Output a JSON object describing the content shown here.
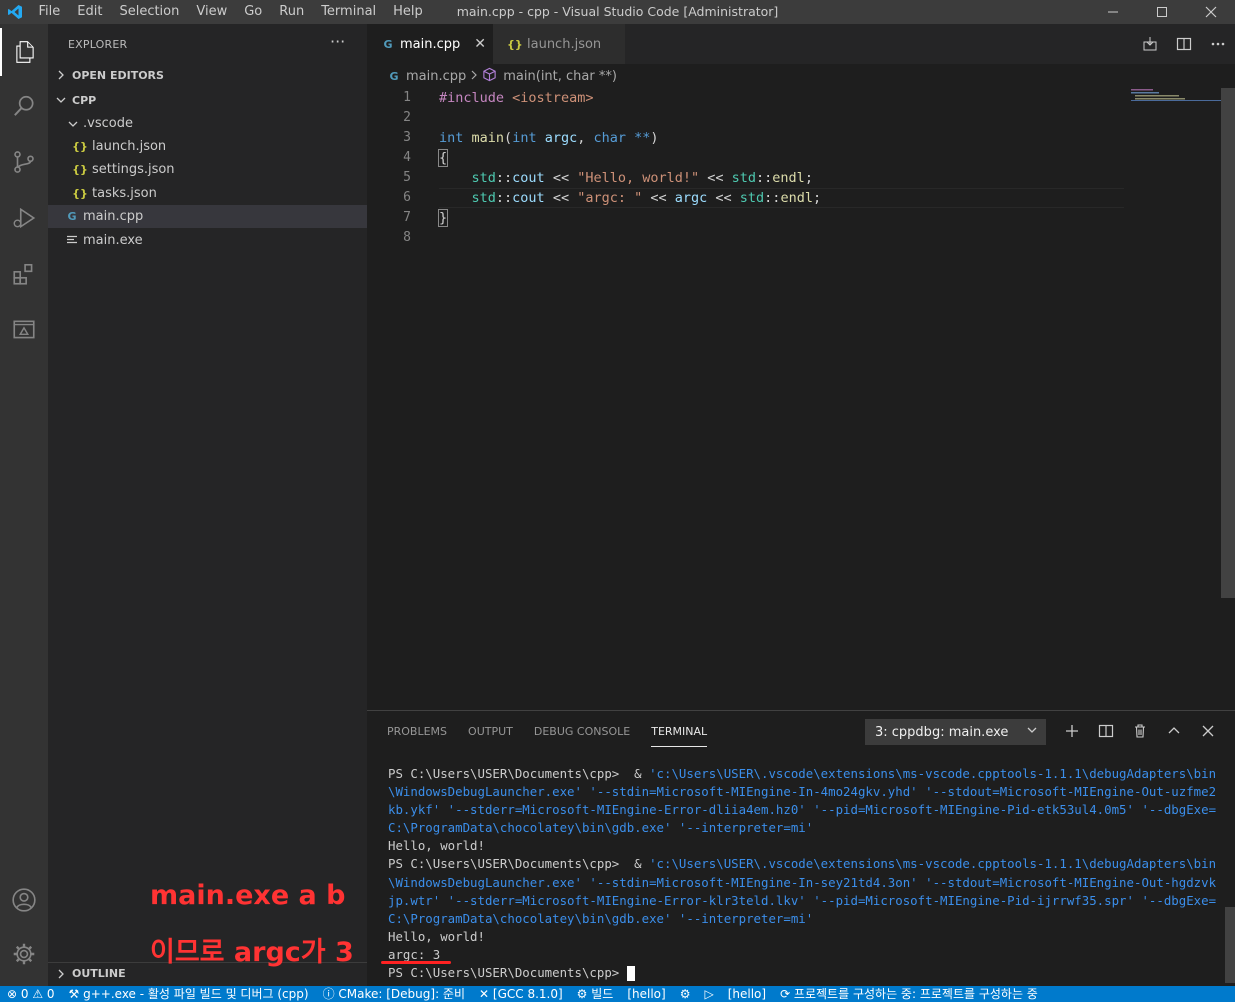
{
  "colors": {
    "status_bar": "#007acc",
    "activity_bar": "#333333",
    "sidebar": "#252526",
    "editor": "#1e1e1e",
    "annotation": "#ff3333"
  },
  "titlebar": {
    "menu": [
      "File",
      "Edit",
      "Selection",
      "View",
      "Go",
      "Run",
      "Terminal",
      "Help"
    ],
    "title": "main.cpp - cpp - Visual Studio Code [Administrator]"
  },
  "sidebar": {
    "title": "EXPLORER",
    "more": "···",
    "open_editors": "OPEN EDITORS",
    "folder": "CPP",
    "vscode_folder": ".vscode",
    "files": [
      "launch.json",
      "settings.json",
      "tasks.json"
    ],
    "cpp_file": "main.cpp",
    "exe_file": "main.exe",
    "outline": "OUTLINE",
    "json_glyph": "{}",
    "cpp_glyph": "G"
  },
  "annotation": {
    "line1": "main.exe a b",
    "line2": "이므로 argc가 3"
  },
  "tabs": [
    {
      "label": "main.cpp",
      "close": "✕"
    },
    {
      "label": "launch.json"
    }
  ],
  "breadcrumb": {
    "file": "main.cpp",
    "symbol": "main(int, char **)"
  },
  "editor": {
    "line_numbers": [
      "1",
      "2",
      "3",
      "4",
      "5",
      "6",
      "7",
      "8"
    ]
  },
  "panel": {
    "tabs": [
      "PROBLEMS",
      "OUTPUT",
      "DEBUG CONSOLE",
      "TERMINAL"
    ],
    "terminal_select": "3: cppdbg: main.exe",
    "terminal": {
      "p1_prompt": "PS C:\\Users\\USER\\Documents\\cpp>  & ",
      "p1_l1": "'c:\\Users\\USER\\.vscode\\extensions\\ms-vscode.cpptools-1.1.1\\debugAdapters\\bin",
      "p1_l2": "\\WindowsDebugLauncher.exe' '--stdin=Microsoft-MIEngine-In-4mo24gkv.yhd' '--stdout=Microsoft-MIEngine-Out-uzfme2",
      "p1_l3": "kb.ykf' '--stderr=Microsoft-MIEngine-Error-dliia4em.hz0' '--pid=Microsoft-MIEngine-Pid-etk53ul4.0m5' '--dbgExe=",
      "p1_l4": "C:\\ProgramData\\chocolatey\\bin\\gdb.exe' '--interpreter=mi'",
      "out1": "Hello, world!",
      "p2_prompt": "PS C:\\Users\\USER\\Documents\\cpp>  & ",
      "p2_l1": "'c:\\Users\\USER\\.vscode\\extensions\\ms-vscode.cpptools-1.1.1\\debugAdapters\\bin",
      "p2_l2": "\\WindowsDebugLauncher.exe' '--stdin=Microsoft-MIEngine-In-sey21td4.3on' '--stdout=Microsoft-MIEngine-Out-hgdzvk",
      "p2_l3": "jp.wtr' '--stderr=Microsoft-MIEngine-Error-klr3teld.lkv' '--pid=Microsoft-MIEngine-Pid-ijrrwf35.spr' '--dbgExe=",
      "p2_l4": "C:\\ProgramData\\chocolatey\\bin\\gdb.exe' '--interpreter=mi'",
      "out2": "Hello, world!",
      "out3": "argc: 3",
      "final_prompt": "PS C:\\Users\\USER\\Documents\\cpp> "
    }
  },
  "statusbar": {
    "errors": "⊗ 0 ⚠ 0",
    "build_task": "g++.exe - 활성 파일 빌드 및 디버그 (cpp)",
    "cmake": "ⓘ CMake: [Debug]: 준비",
    "gcc": "✕ [GCC 8.1.0]",
    "build": "⚙ 빌드",
    "hello1": "[hello]",
    "gear": "⚙",
    "run": "▷",
    "hello2": "[hello]",
    "configuring": "⟳ 프로젝트를 구성하는 중: 프로젝트를 구성하는 중"
  }
}
